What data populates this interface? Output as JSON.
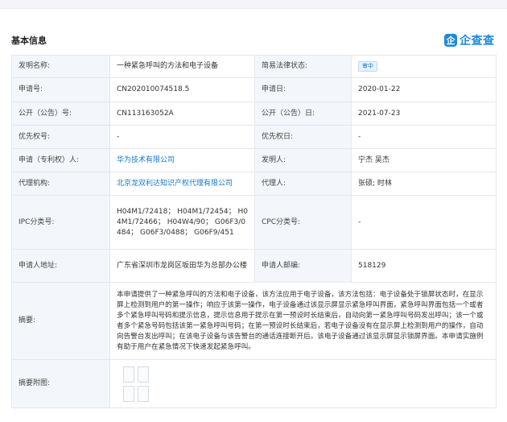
{
  "header": {
    "section_title": "基本信息",
    "brand_logo_char": "企",
    "brand_name": "企查查",
    "brand_color": "#1a8be0"
  },
  "rows": [
    {
      "l1": "发明名称:",
      "v1": "一种紧急呼叫的方法和电子设备",
      "l2": "简易法律状态:",
      "v2_tag": "审中"
    },
    {
      "l1": "申请号:",
      "v1": "CN202010074518.5",
      "l2": "申请日:",
      "v2": "2020-01-22"
    },
    {
      "l1": "公开（公告）号:",
      "v1": "CN113163052A",
      "l2": "公开（公告）日:",
      "v2": "2021-07-23"
    },
    {
      "l1": "优先权号:",
      "v1": "-",
      "l2": "优先权日:",
      "v2": "-"
    },
    {
      "l1": "申请（专利权）人:",
      "v1_link": "华为技术有限公司",
      "l2": "发明人:",
      "v2": "宁杰 吴杰"
    },
    {
      "l1": "代理机构:",
      "v1_link": "北京龙双利达知识产权代理有限公司",
      "l2": "代理人:",
      "v2": "张硕; 时林"
    },
    {
      "l1": "IPC分类号:",
      "v1": "H04M1/72418； H04M1/72454； H04M1/72466； H04W4/90； G06F3/0484； G06F3/0488； G06F9/451",
      "l2": "CPC分类号:",
      "v2": "-"
    },
    {
      "l1": "申请人地址:",
      "v1": "广东省深圳市龙岗区坂田华为总部办公楼",
      "l2": "申请人邮编:",
      "v2": "518129"
    }
  ],
  "abstract": {
    "label": "摘要:",
    "text": "本申请提供了一种紧急呼叫的方法和电子设备，该方法应用于电子设备，该方法包括：电子设备处于锁屏状态时，在显示屏上检测到用户的第一操作；响应于该第一操作，电子设备通过该显示屏显示紧急呼叫界面，紧急呼叫界面包括一个或者多个紧急呼叫号码和提示信息，提示信息用于提示在第一预设时长结束后，自动向第一紧急呼叫号码发出呼叫；该一个或者多个紧急号码包括该第一紧急呼叫号码；在第一预设时长结束后，若电子设备没有在显示屏上检测到用户的操作，自动向告警台发出呼叫；在该电子设备与该告警台的通话连接断开后，该电子设备通过该显示屏显示锁屏界面。本申请实施例有助于用户在紧急情况下快速发起紧急呼叫。"
  },
  "figure_row": {
    "label": "摘要附图:"
  }
}
